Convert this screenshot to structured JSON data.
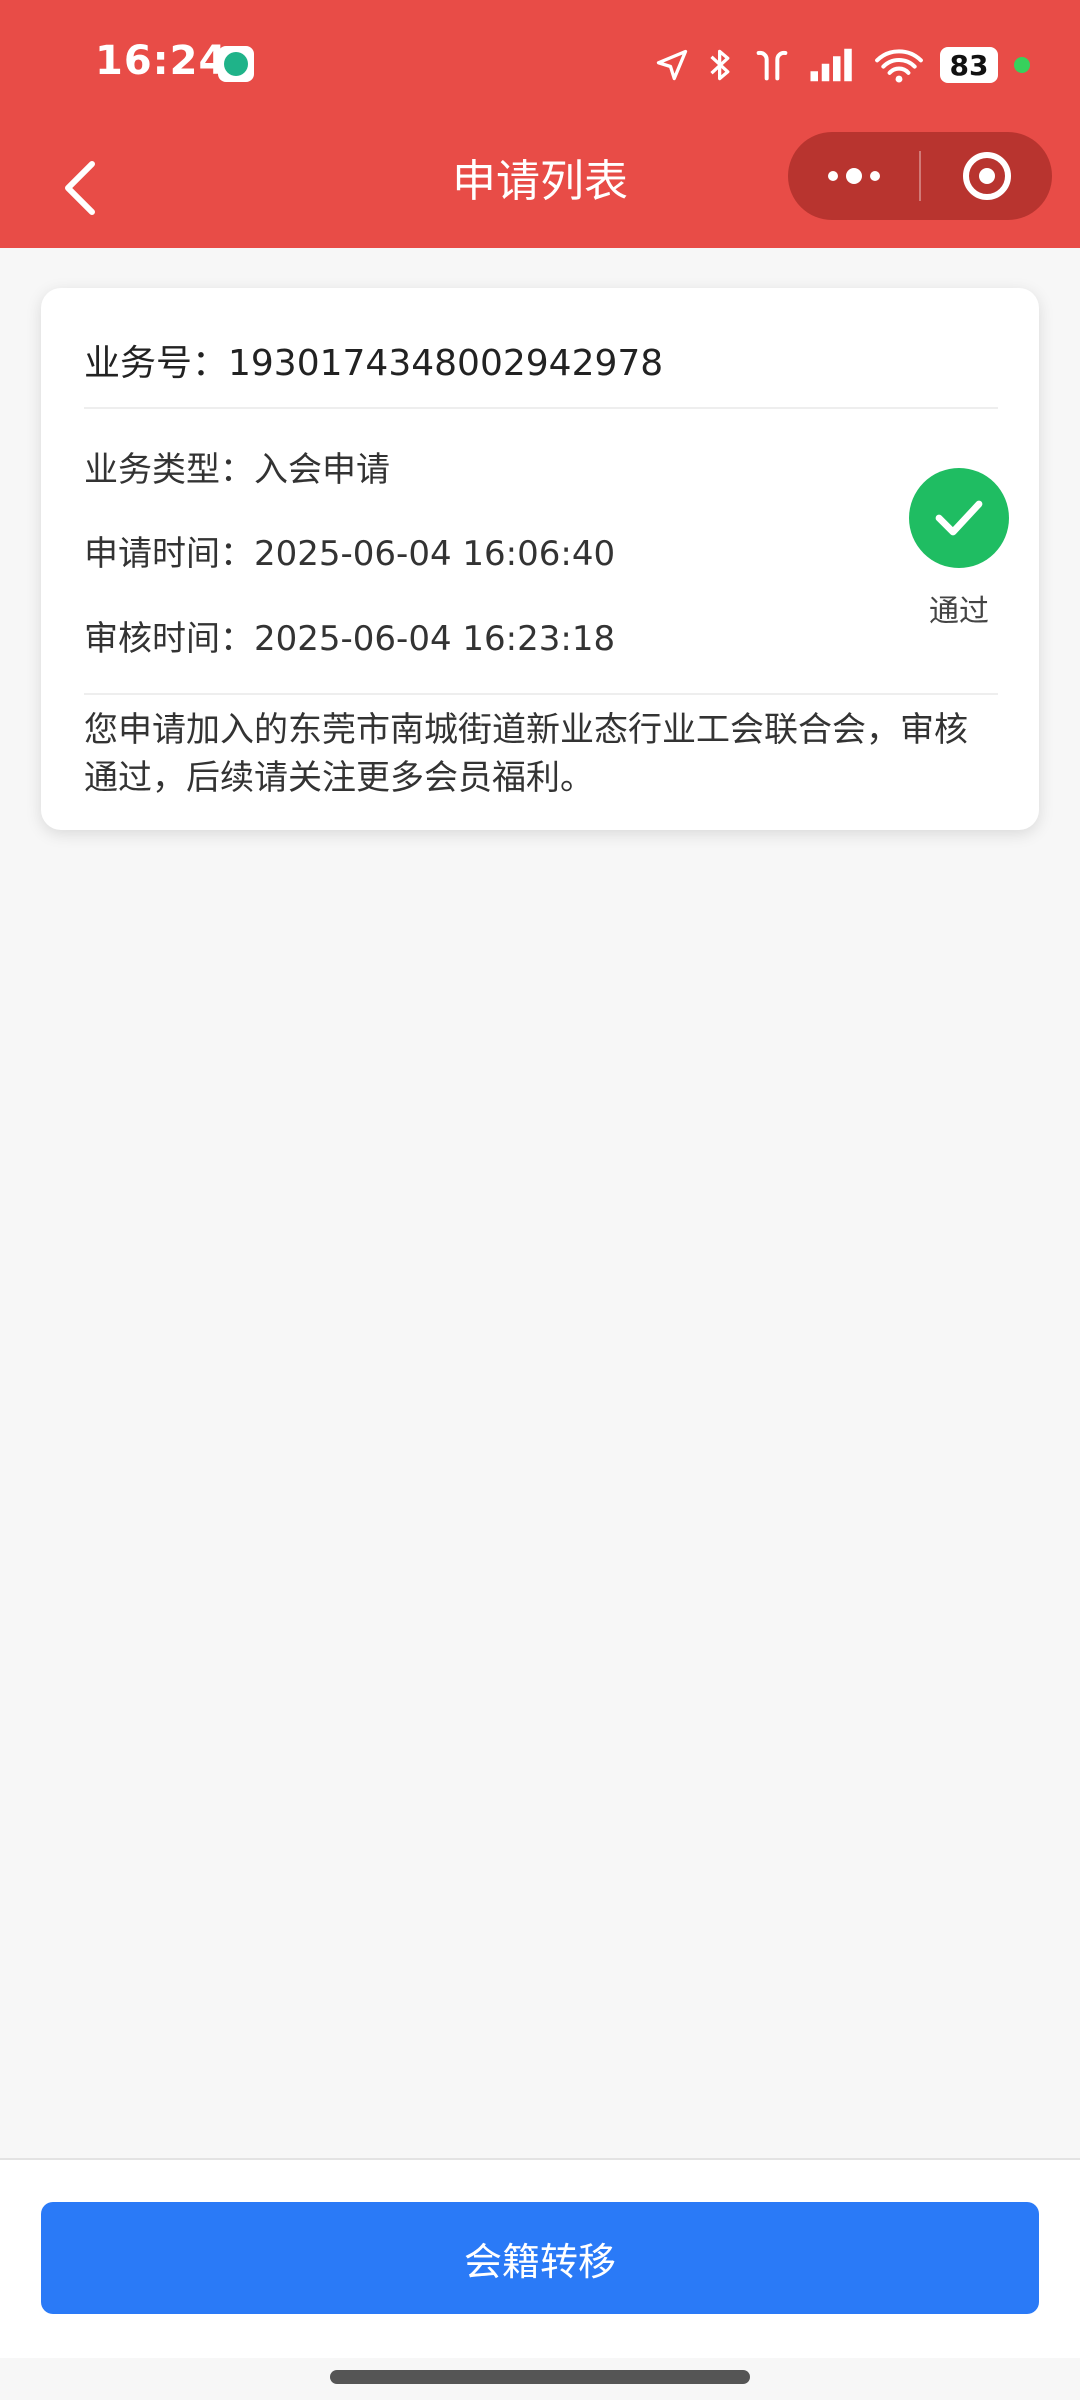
{
  "status_bar": {
    "time": "16:24",
    "battery": "83",
    "icons": [
      "location-icon",
      "bluetooth-icon",
      "earbuds-icon",
      "signal-icon",
      "wifi-icon",
      "battery-icon"
    ]
  },
  "navbar": {
    "title": "申请列表",
    "colors": {
      "background": "#e84c47",
      "capsule": "#b8342f"
    }
  },
  "application": {
    "business_number": "业务号：1930174348002942978",
    "business_type": "业务类型：入会申请",
    "apply_time": "申请时间：2025-06-04 16:06:40",
    "review_time": "审核时间：2025-06-04 16:23:18",
    "status": "通过",
    "message": "您申请加入的东莞市南城街道新业态行业工会联合会，审核通过，后续请关注更多会员福利。",
    "status_color": "#1fbd62"
  },
  "footer": {
    "button_label": "会籍转移",
    "button_color": "#2a7af7"
  }
}
